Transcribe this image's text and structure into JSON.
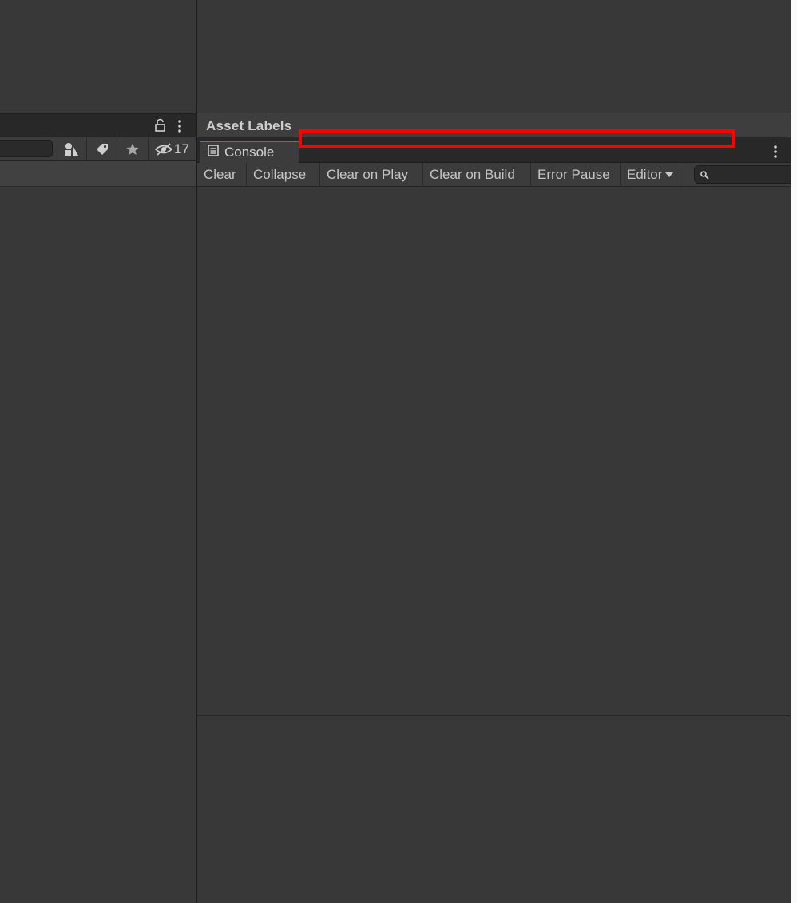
{
  "project_panel": {
    "hidden_count": "17",
    "icons": [
      "lock-icon",
      "menu-dots-icon",
      "search-by-type-icon",
      "label-tag-icon",
      "favorite-star-icon",
      "visibility-eye-icon"
    ]
  },
  "inspector": {
    "section_title": "Asset Labels"
  },
  "console": {
    "tab_label": "Console",
    "toolbar": {
      "clear": "Clear",
      "collapse": "Collapse",
      "clear_on_play": "Clear on Play",
      "clear_on_build": "Clear on Build",
      "error_pause": "Error Pause",
      "editor": "Editor"
    },
    "search_value": ""
  },
  "colors": {
    "panel_bg": "#383838",
    "header_bg": "#282828",
    "toolbar_bg": "#3c3c3c",
    "highlight": "#ff0000",
    "tab_accent": "#3a79bb"
  }
}
